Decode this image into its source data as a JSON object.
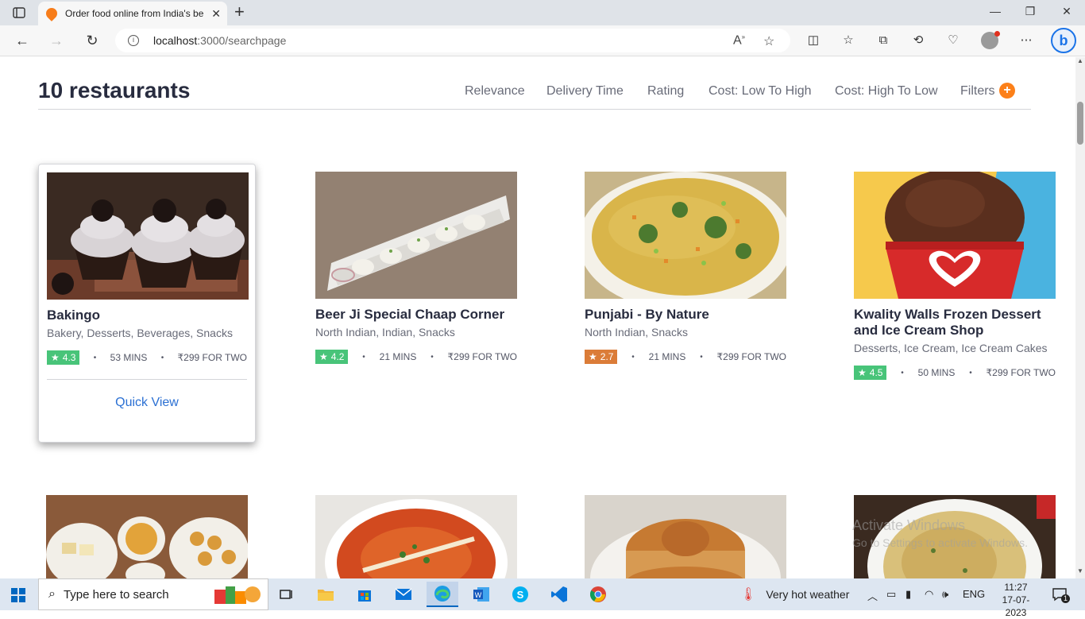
{
  "browser": {
    "tab_title": "Order food online from India's be",
    "url_host": "localhost",
    "url_path": ":3000/searchpage"
  },
  "page": {
    "results_count": "10 restaurants",
    "sort_options": [
      "Relevance",
      "Delivery Time",
      "Rating",
      "Cost: Low To High",
      "Cost: High To Low"
    ],
    "filters_label": "Filters",
    "filters_badge": "+",
    "quick_view_label": "Quick View"
  },
  "restaurants": [
    {
      "name": "Bakingo",
      "cuisines": "Bakery, Desserts, Beverages, Snacks",
      "rating": "4.3",
      "rating_color": "#48c479",
      "time": "53 MINS",
      "cost": "₹299 FOR TWO"
    },
    {
      "name": "Beer Ji Special Chaap Corner",
      "cuisines": "North Indian, Indian, Snacks",
      "rating": "4.2",
      "rating_color": "#48c479",
      "time": "21 MINS",
      "cost": "₹299 FOR TWO"
    },
    {
      "name": "Punjabi - By Nature",
      "cuisines": "North Indian, Snacks",
      "rating": "2.7",
      "rating_color": "#db7c38",
      "time": "21 MINS",
      "cost": "₹299 FOR TWO"
    },
    {
      "name": "Kwality Walls Frozen Dessert and Ice Cream Shop",
      "cuisines": "Desserts, Ice Cream, Ice Cream Cakes",
      "rating": "4.5",
      "rating_color": "#48c479",
      "time": "50 MINS",
      "cost": "₹299 FOR TWO"
    }
  ],
  "watermark": {
    "line1": "Activate Windows",
    "line2": "Go to Settings to activate Windows."
  },
  "taskbar": {
    "search_placeholder": "Type here to search",
    "weather": "Very hot weather",
    "language": "ENG",
    "time": "11:27",
    "date": "17-07-2023",
    "notification_count": "1"
  }
}
